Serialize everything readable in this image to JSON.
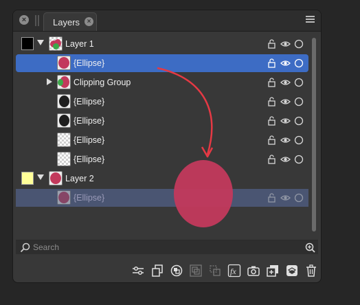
{
  "panel": {
    "tab_label": "Layers"
  },
  "layers": [
    {
      "label": "Layer 1",
      "swatch": "#000000",
      "expanded": true
    },
    {
      "label": "{Ellipse}",
      "selected": true
    },
    {
      "label": "Clipping Group",
      "expanded": false
    },
    {
      "label": "{Ellipse}"
    },
    {
      "label": "{Ellipse}"
    },
    {
      "label": "{Ellipse}"
    },
    {
      "label": "{Ellipse}"
    },
    {
      "label": "Layer 2",
      "swatch": "#ffff99",
      "expanded": true
    },
    {
      "label": "{Ellipse}",
      "dragging": true
    }
  ],
  "search": {
    "placeholder": "Search"
  },
  "toolbar": {
    "items": [
      "adjustments-icon",
      "duplicate-icon",
      "boolean-icon",
      "group-icon",
      "ungroup-icon",
      "fx-icon",
      "camera-icon",
      "add-layer-icon",
      "arrange-icon",
      "trash-icon"
    ]
  },
  "colors": {
    "ellipse": "#c2395c",
    "selection": "#3d6cc4",
    "arrow": "#e53944"
  }
}
